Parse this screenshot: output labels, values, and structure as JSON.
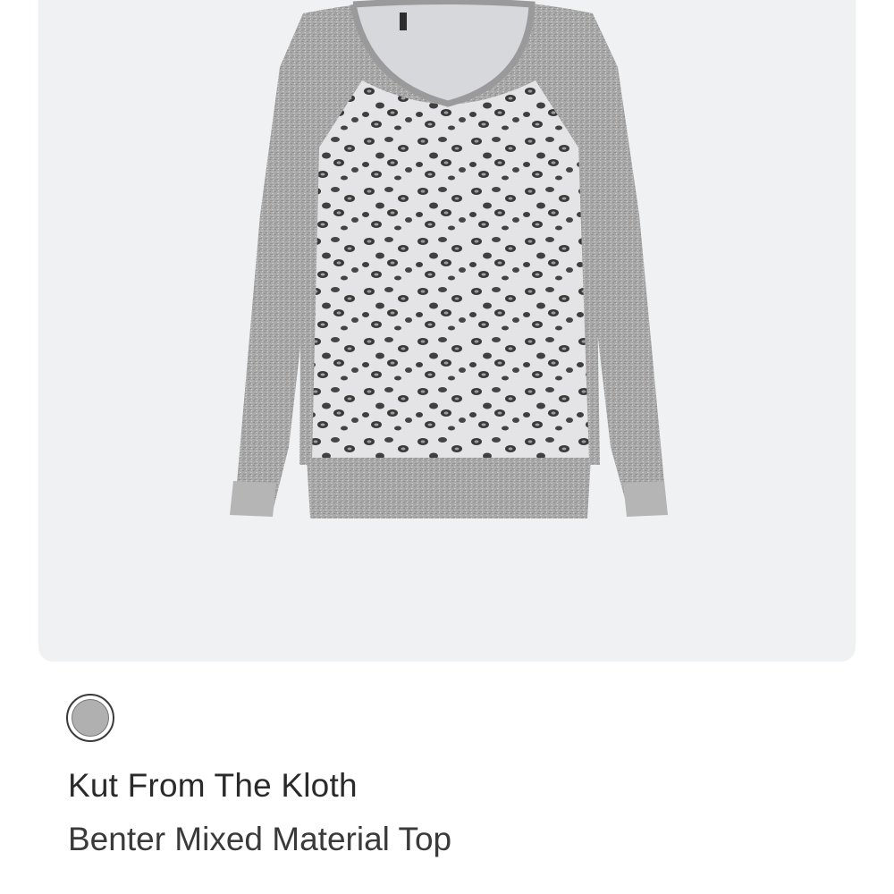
{
  "product": {
    "image_icon": "sweater-product-image",
    "swatch_color": "#b0b0b0",
    "brand": "Kut From The Kloth",
    "name": "Benter Mixed Material Top"
  },
  "colors": {
    "panel_background": "#eff1f3",
    "heather_gray": "#a8a8a8",
    "leopard_base": "#e6e6e8",
    "leopard_spot": "#3c3c3c"
  }
}
